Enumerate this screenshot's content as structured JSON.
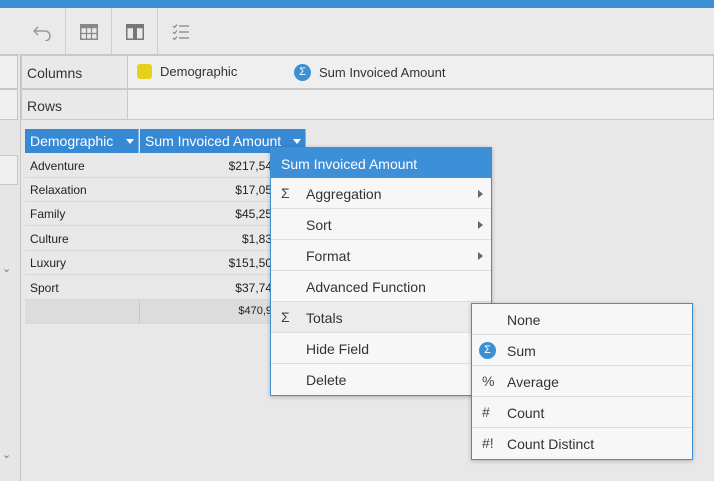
{
  "colors": {
    "accent": "#3d8fd8",
    "swatch_demographic": "#e6d11a"
  },
  "toolbar": {
    "buttons": [
      {
        "name": "undo-button",
        "icon": "undo-icon"
      },
      {
        "name": "table-layout-button",
        "icon": "grid-icon"
      },
      {
        "name": "column-layout-button",
        "icon": "columns-icon"
      },
      {
        "name": "field-list-button",
        "icon": "checklist-icon"
      }
    ]
  },
  "zones": {
    "columns": {
      "label": "Columns",
      "chips": [
        "Demographic",
        "Sum Invoiced Amount"
      ],
      "sigma": "Σ"
    },
    "rows": {
      "label": "Rows"
    }
  },
  "grid": {
    "headers": [
      "Demographic",
      "Sum Invoiced Amount"
    ],
    "rows": [
      {
        "name": "Adventure",
        "value": "$217,54"
      },
      {
        "name": "Relaxation",
        "value": "$17,05"
      },
      {
        "name": "Family",
        "value": "$45,25"
      },
      {
        "name": "Culture",
        "value": "$1,83"
      },
      {
        "name": "Luxury",
        "value": "$151,50"
      },
      {
        "name": "Sport",
        "value": "$37,74"
      }
    ],
    "total": "$470,9"
  },
  "context_menu": {
    "title": "Sum Invoiced Amount",
    "items": [
      {
        "label": "Aggregation",
        "icon": "Σ"
      },
      {
        "label": "Sort"
      },
      {
        "label": "Format"
      },
      {
        "label": "Advanced Function"
      },
      {
        "label": "Totals",
        "icon": "Σ"
      },
      {
        "label": "Hide Field"
      },
      {
        "label": "Delete"
      }
    ]
  },
  "totals_submenu": {
    "items": [
      {
        "label": "None",
        "icon": ""
      },
      {
        "label": "Sum",
        "icon": "Σ"
      },
      {
        "label": "Average",
        "icon": "%"
      },
      {
        "label": "Count",
        "icon": "#"
      },
      {
        "label": "Count Distinct",
        "icon": "#!"
      }
    ]
  }
}
